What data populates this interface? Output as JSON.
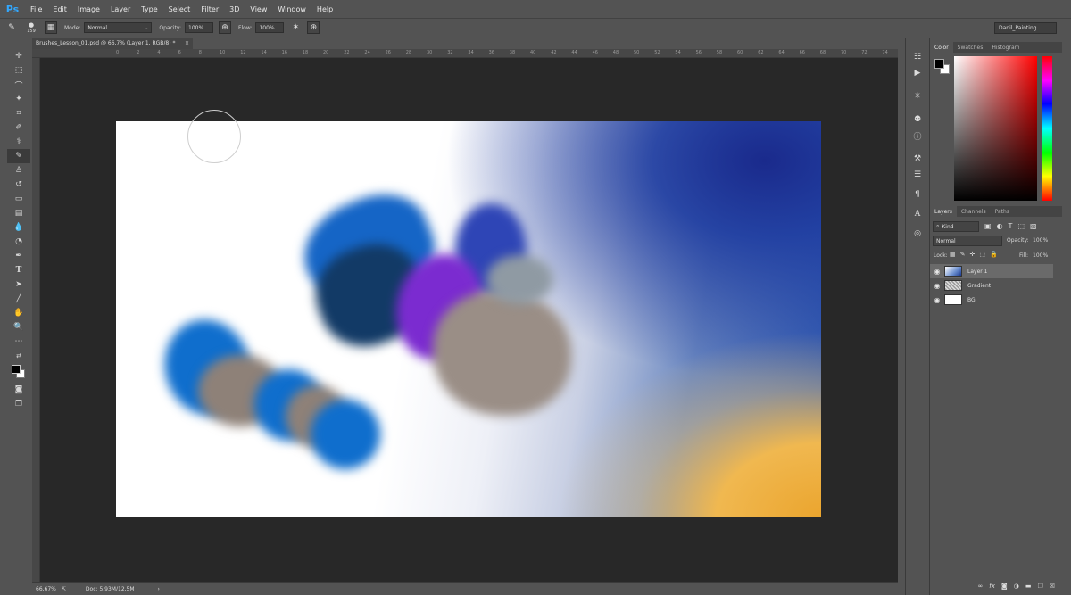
{
  "app": {
    "logo": "Ps"
  },
  "menu": [
    "File",
    "Edit",
    "Image",
    "Layer",
    "Type",
    "Select",
    "Filter",
    "3D",
    "View",
    "Window",
    "Help"
  ],
  "options": {
    "brush_size": "159",
    "mode_label": "Mode:",
    "mode_value": "Normal",
    "opacity_label": "Opacity:",
    "opacity_value": "100%",
    "flow_label": "Flow:",
    "flow_value": "100%",
    "workspace": "Danil_Painting"
  },
  "document": {
    "tab_title": "Brushes_Lesson_01.psd @ 66,7% (Layer 1, RGB/8) *",
    "close_glyph": "×",
    "zoom": "66,67%",
    "doc_info": "Doc: 5,93M/12,5M"
  },
  "ruler_ticks": [
    "0",
    "2",
    "4",
    "6",
    "8",
    "10",
    "12",
    "14",
    "16",
    "18",
    "20",
    "22",
    "24",
    "26",
    "28",
    "30",
    "32",
    "34",
    "36",
    "38",
    "40",
    "42",
    "44",
    "46",
    "48",
    "50",
    "52",
    "54",
    "56",
    "58",
    "60",
    "62",
    "64",
    "66",
    "68",
    "70",
    "72",
    "74"
  ],
  "color_panel": {
    "tabs": [
      "Color",
      "Swatches",
      "Histogram"
    ],
    "foreground": "#000000",
    "background": "#ffffff"
  },
  "layers_panel": {
    "tabs": [
      "Layers",
      "Channels",
      "Paths"
    ],
    "filter_kind": "Kind",
    "blend_mode": "Normal",
    "opacity_label": "Opacity:",
    "opacity_value": "100%",
    "lock_label": "Lock:",
    "fill_label": "Fill:",
    "fill_value": "100%",
    "layers": [
      {
        "name": "Layer 1",
        "selected": true
      },
      {
        "name": "Gradient",
        "selected": false
      },
      {
        "name": "BG",
        "selected": false
      }
    ],
    "bottom_icons": [
      "link-icon",
      "fx-icon",
      "mask-icon",
      "adjustment-icon",
      "folder-icon",
      "new-layer-icon",
      "trash-icon"
    ]
  },
  "colors": {
    "accent": "#32a8ff",
    "panel_bg": "#535353",
    "pasteboard": "#282828"
  }
}
